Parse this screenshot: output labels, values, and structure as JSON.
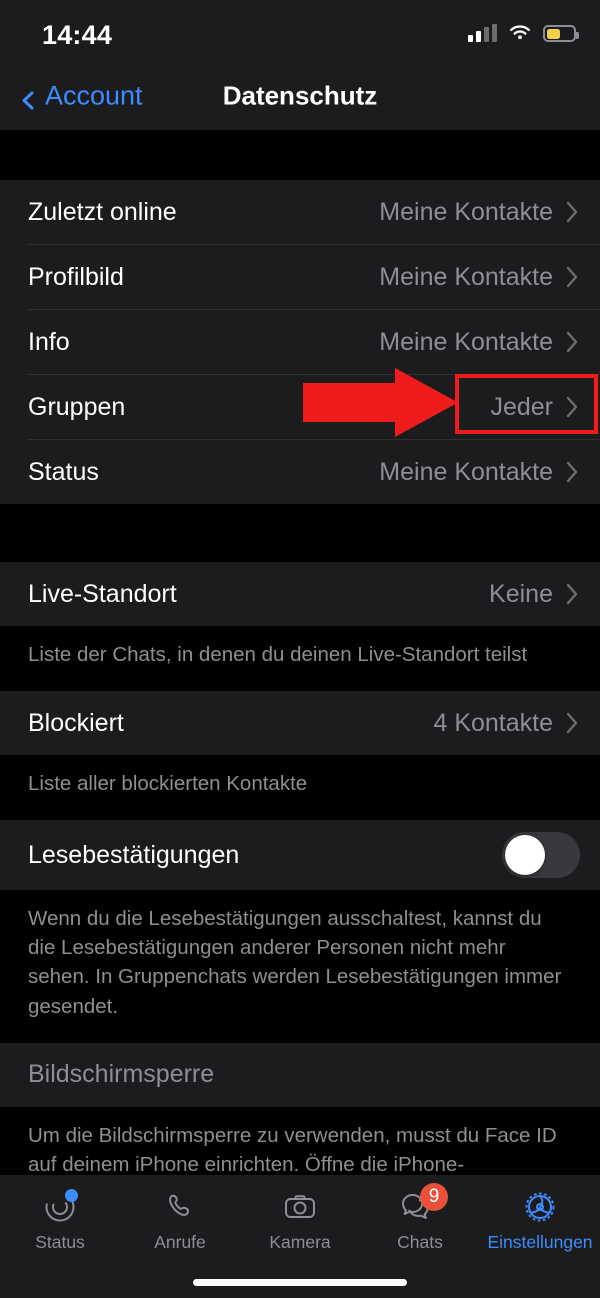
{
  "status_bar": {
    "time": "14:44",
    "signal_icon": "cellular-signal-icon",
    "wifi_icon": "wifi-icon",
    "battery_icon": "battery-icon",
    "battery_color": "#f5d04a",
    "battery_level_percent": 45
  },
  "nav": {
    "back_label": "Account",
    "back_icon": "chevron-left-icon",
    "title": "Datenschutz",
    "accent_color": "#3d8bfd"
  },
  "groups": [
    {
      "rows": [
        {
          "label": "Zuletzt online",
          "value": "Meine Kontakte",
          "chevron": true
        },
        {
          "label": "Profilbild",
          "value": "Meine Kontakte",
          "chevron": true
        },
        {
          "label": "Info",
          "value": "Meine Kontakte",
          "chevron": true
        },
        {
          "label": "Gruppen",
          "value": "Jeder",
          "chevron": true
        },
        {
          "label": "Status",
          "value": "Meine Kontakte",
          "chevron": true
        }
      ]
    }
  ],
  "live_location": {
    "label": "Live-Standort",
    "value": "Keine",
    "footer": "Liste der Chats, in denen du deinen Live-Standort teilst"
  },
  "blocked": {
    "label": "Blockiert",
    "value": "4 Kontakte",
    "footer": "Liste aller blockierten Kontakte"
  },
  "read_receipts": {
    "label": "Lesebestätigungen",
    "toggle_state": "off",
    "footer": "Wenn du die Lesebestätigungen ausschaltest, kannst du die Lesebestätigungen anderer Personen nicht mehr sehen. In Gruppenchats werden Lesebestätigungen immer gesendet."
  },
  "screen_lock": {
    "label": "Bildschirmsperre",
    "disabled": true,
    "footer": "Um die Bildschirmsperre zu verwenden, musst du Face ID auf deinem iPhone einrichten. Öffne die iPhone-Einstellungen und tippe auf „Face ID & Code“."
  },
  "tabbar": {
    "items": [
      {
        "label": "Status",
        "icon": "status-rings-icon",
        "badge_dot": true,
        "active": false
      },
      {
        "label": "Anrufe",
        "icon": "phone-icon",
        "active": false
      },
      {
        "label": "Kamera",
        "icon": "camera-icon",
        "active": false
      },
      {
        "label": "Chats",
        "icon": "chat-bubbles-icon",
        "badge": "9",
        "active": false
      },
      {
        "label": "Einstellungen",
        "icon": "gear-icon",
        "active": true
      }
    ],
    "badge_color": "#e8503a",
    "active_color": "#3d8bfd"
  },
  "annotation": {
    "highlight_color": "#f01c1c",
    "arrow_icon": "red-arrow-right",
    "highlighted_value": "Jeder"
  }
}
